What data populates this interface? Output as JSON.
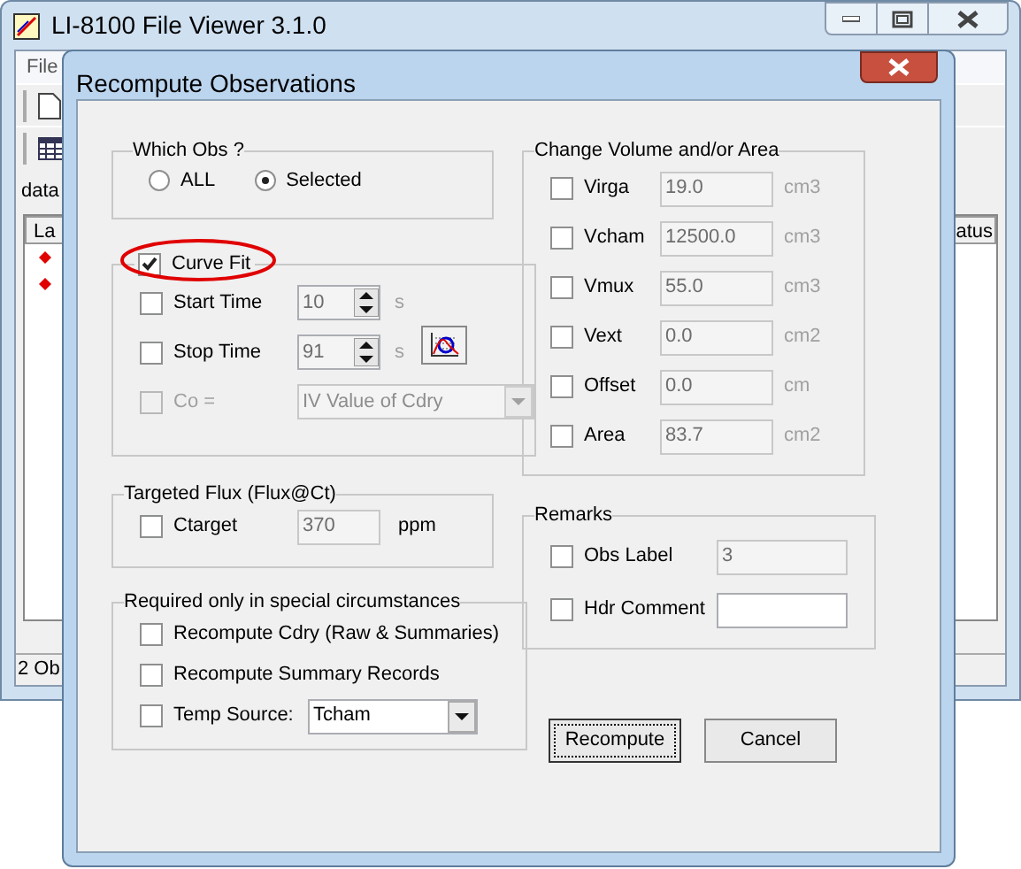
{
  "app_window": {
    "title": "LI-8100 File Viewer 3.1.0",
    "menu": [
      "File"
    ],
    "path_text": "data",
    "columns": [
      "La",
      "atus"
    ],
    "rows": [
      {
        "kind": "marker",
        "color": "#e00000"
      },
      {
        "kind": "marker",
        "color": "#e00000"
      }
    ],
    "status_bar": "2 Ob"
  },
  "dialog": {
    "title": "Recompute Observations",
    "which_obs": {
      "legend": "Which Obs ?",
      "options": [
        {
          "label": "ALL",
          "selected": false
        },
        {
          "label": "Selected",
          "selected": true
        }
      ]
    },
    "curve_fit": {
      "label": "Curve Fit",
      "checked": true,
      "circled": true,
      "rows": [
        {
          "kind": "spin",
          "label": "Start Time",
          "checked": false,
          "value": "10",
          "unit": "s",
          "disabled": false
        },
        {
          "kind": "spin",
          "label": "Stop Time",
          "checked": false,
          "value": "91",
          "unit": "s",
          "disabled": false
        },
        {
          "kind": "combo",
          "label": "Co =",
          "checked": false,
          "value": "IV Value of Cdry",
          "disabled": true
        }
      ]
    },
    "targeted_flux": {
      "legend": "Targeted Flux (Flux@Ct)",
      "label": "Ctarget",
      "checked": false,
      "value": "370",
      "unit": "ppm",
      "field_disabled": true
    },
    "special": {
      "legend": "Required only in special circumstances",
      "rows": [
        {
          "kind": "check",
          "label": "Recompute Cdry (Raw & Summaries)",
          "checked": false
        },
        {
          "kind": "check",
          "label": "Recompute Summary Records",
          "checked": false
        },
        {
          "kind": "combo",
          "label": "Temp Source:",
          "checked": false,
          "value": "Tcham"
        }
      ]
    },
    "volume": {
      "legend": "Change Volume and/or Area",
      "rows": [
        {
          "label": "Virga",
          "checked": false,
          "value": "19.0",
          "unit": "cm3",
          "disabled": true
        },
        {
          "label": "Vcham",
          "checked": false,
          "value": "12500.0",
          "unit": "cm3",
          "disabled": true
        },
        {
          "label": "Vmux",
          "checked": false,
          "value": "55.0",
          "unit": "cm3",
          "disabled": true
        },
        {
          "label": "Vext",
          "checked": false,
          "value": "0.0",
          "unit": "cm2",
          "disabled": true
        },
        {
          "label": "Offset",
          "checked": false,
          "value": "0.0",
          "unit": "cm",
          "disabled": true
        },
        {
          "label": "Area",
          "checked": false,
          "value": "83.7",
          "unit": "cm2",
          "disabled": true
        }
      ]
    },
    "remarks": {
      "legend": "Remarks",
      "rows": [
        {
          "label": "Obs Label",
          "checked": false,
          "value": "3",
          "disabled": true
        },
        {
          "label": "Hdr Comment",
          "checked": false,
          "disabled": false
        }
      ]
    },
    "buttons": [
      {
        "label": "Recompute",
        "default": true
      },
      {
        "label": "Cancel",
        "default": false
      }
    ]
  }
}
